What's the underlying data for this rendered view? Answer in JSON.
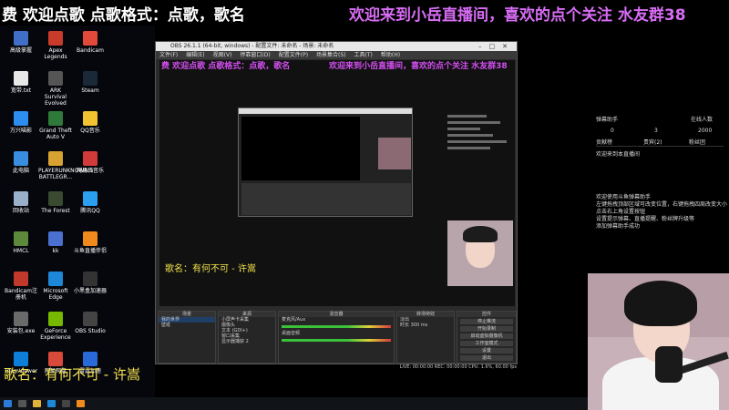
{
  "banner": {
    "left": "费 欢迎点歌 点歌格式：点歌，歌名",
    "right": "欢迎来到小岳直播间，喜欢的点个关注 水友群38"
  },
  "desktop_icons": [
    {
      "label": "高级掌握",
      "color": "#3f6fc6"
    },
    {
      "label": "Apex Legends",
      "color": "#c93b2b"
    },
    {
      "label": "Bandicam",
      "color": "#e14a3a"
    },
    {
      "label": "宽带.txt",
      "color": "#e8e8e8"
    },
    {
      "label": "ARK Survival Evolved",
      "color": "#555555"
    },
    {
      "label": "Steam",
      "color": "#1b2838"
    },
    {
      "label": "万兴喵影",
      "color": "#2d8df0"
    },
    {
      "label": "Grand Theft Auto V",
      "color": "#2f7a3a"
    },
    {
      "label": "QQ音乐",
      "color": "#f2c230"
    },
    {
      "label": "此电脑",
      "color": "#3a8ee0"
    },
    {
      "label": "PLAYERUNKNOWN'S BATTLEGR...",
      "color": "#d8a232"
    },
    {
      "label": "网易云音乐",
      "color": "#d33a3a"
    },
    {
      "label": "回收站",
      "color": "#9ab0c8"
    },
    {
      "label": "The Forest",
      "color": "#3a4a30"
    },
    {
      "label": "腾讯QQ",
      "color": "#2ba0f0"
    },
    {
      "label": "HMCL",
      "color": "#5c8a3a"
    },
    {
      "label": "kk",
      "color": "#4a70d0"
    },
    {
      "label": "斗鱼直播伴侣",
      "color": "#f08a1c"
    },
    {
      "label": "Bandicam注册机",
      "color": "#c0392b"
    },
    {
      "label": "Microsoft Edge",
      "color": "#1e88d8"
    },
    {
      "label": "小黑盒加速器",
      "color": "#333333"
    },
    {
      "label": "安装包.exe",
      "color": "#6a6a6a"
    },
    {
      "label": "GeForce Experience",
      "color": "#76b900"
    },
    {
      "label": "OBS Studio",
      "color": "#444444"
    },
    {
      "label": "TeamViewer",
      "color": "#0e7fd8"
    },
    {
      "label": "网易网盘",
      "color": "#d84a3a"
    },
    {
      "label": "雷霆加速",
      "color": "#2a6ad8"
    }
  ],
  "obs": {
    "title": "OBS 26.1.1 (64-bit, windows) - 配置文件: 未命名 - 场景: 未命名",
    "menu": [
      "文件(F)",
      "编辑(E)",
      "视图(V)",
      "停靠窗口(D)",
      "配置文件(P)",
      "场景集合(S)",
      "工具(T)",
      "帮助(H)"
    ],
    "preview_song": "歌名：有何不可 - 许嵩",
    "docks": {
      "scenes": {
        "title": "场景",
        "items": [
          "我的世界",
          "壁纸"
        ]
      },
      "sources": {
        "title": "来源",
        "items": [
          "小屏声卡采集",
          "摄像头",
          "文本 (GDI+)",
          "窗口采集",
          "显示器捕获 2"
        ]
      },
      "mixer": {
        "title": "混音器",
        "items": [
          "麦克风/Aux",
          "桌面音频"
        ]
      },
      "transitions": {
        "title": "转场特效",
        "type": "淡出",
        "duration_label": "时长",
        "duration_value": "300 ms"
      },
      "controls": {
        "title": "控件",
        "buttons": [
          "停止推流",
          "开始录制",
          "启动虚拟摄像机",
          "工作室模式",
          "设置",
          "退出"
        ]
      }
    },
    "status": "LIVE: 00:00:00  REC: 00:00:00  CPU: 1.6%, 60.00 fps"
  },
  "rpanel": {
    "title": "弹幕助手",
    "online_label": "在线人数",
    "stats": [
      "0",
      "3",
      "2000"
    ],
    "tabs": [
      "贡献榜",
      "贵宾(2)",
      "粉丝团"
    ],
    "welcome": "欢迎来到本直播间",
    "tips": [
      "欢迎使用斗鱼弹幕助手",
      "左键拖拽顶部区域可改变位置，右键拖拽四周改变大小",
      "点击右上角设置按钮",
      "设置提示弹幕、直播提醒、粉丝牌升级等",
      "添加弹幕助手成功"
    ]
  },
  "song_overlay": "歌名：有何不可 - 许嵩"
}
